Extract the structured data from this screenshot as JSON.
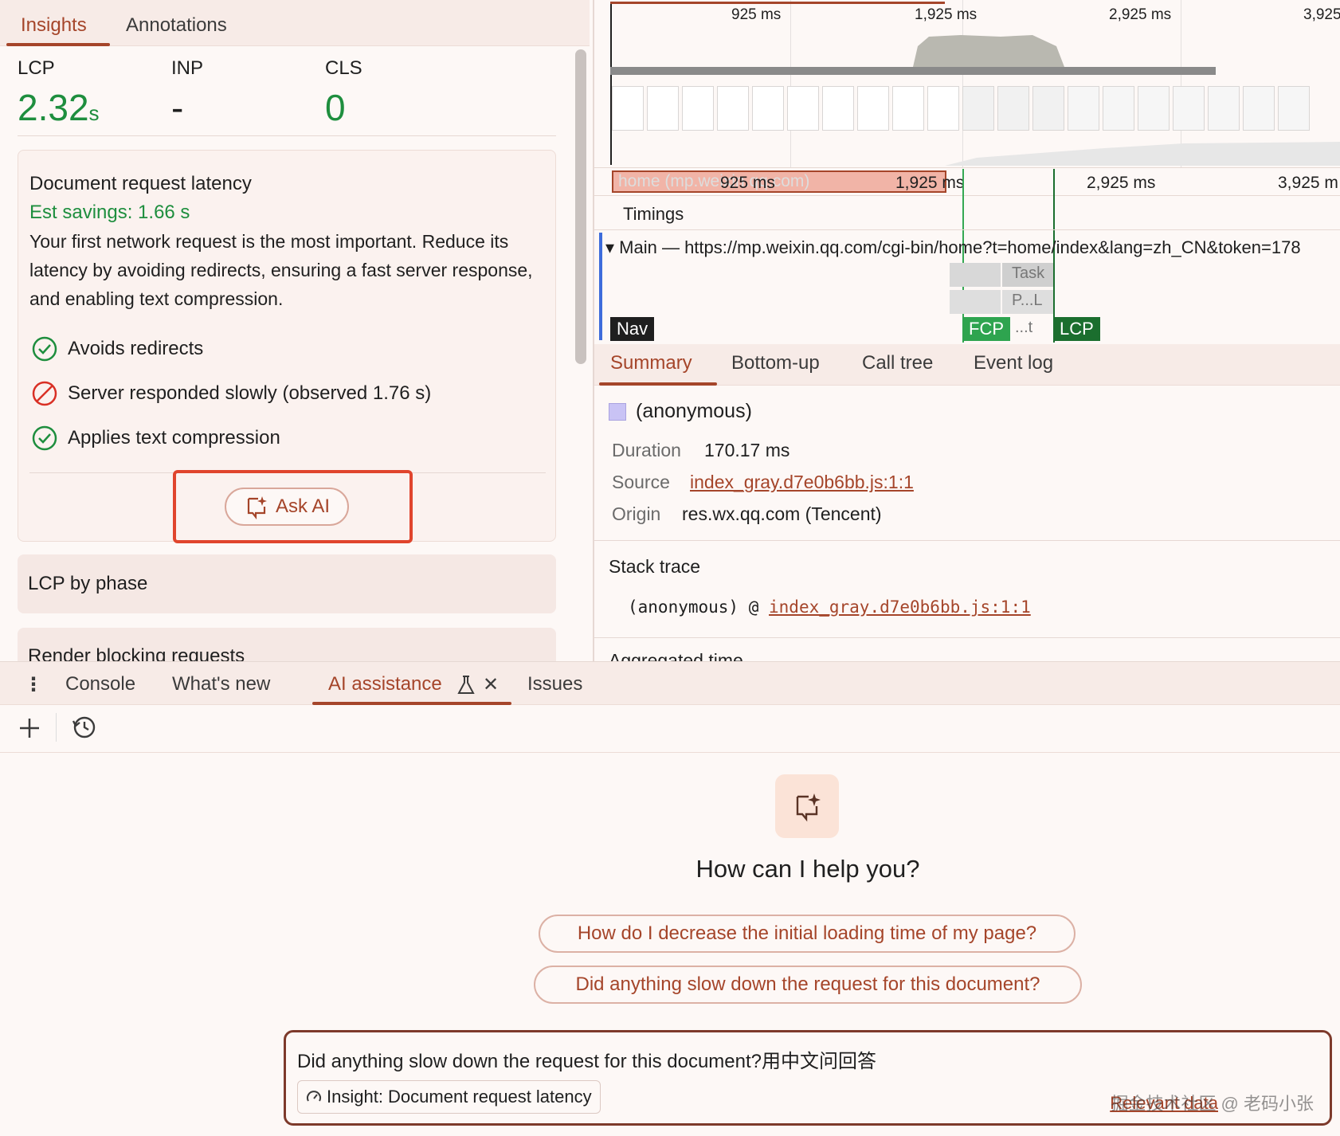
{
  "left_panel": {
    "tabs": [
      {
        "label": "Insights",
        "active": true
      },
      {
        "label": "Annotations",
        "active": false
      }
    ],
    "metrics": [
      {
        "label": "LCP",
        "value": "2.32",
        "unit": "s"
      },
      {
        "label": "INP",
        "value": "-",
        "unit": ""
      },
      {
        "label": "CLS",
        "value": "0",
        "unit": ""
      }
    ],
    "insight_card": {
      "title": "Document request latency",
      "savings": "Est savings: 1.66 s",
      "description": "Your first network request is the most important. Reduce its latency by avoiding redirects, ensuring a fast server response, and enabling text compression.",
      "checks": [
        {
          "label": "Avoids redirects",
          "status": "pass",
          "icon": "check-circle-icon"
        },
        {
          "label": "Server responded slowly (observed 1.76 s)",
          "status": "fail",
          "icon": "blocked-circle-icon"
        },
        {
          "label": "Applies text compression",
          "status": "pass",
          "icon": "check-circle-icon"
        }
      ],
      "ask_ai_label": "Ask AI"
    },
    "sections": [
      {
        "label": "LCP by phase"
      },
      {
        "label": "Render blocking requests"
      }
    ]
  },
  "timeline": {
    "ruler_top": [
      "925 ms",
      "1,925 ms",
      "2,925 ms",
      "3,925"
    ],
    "ruler_main": [
      "925 ms",
      "1,925 ms",
      "2,925 ms",
      "3,925 m"
    ],
    "network_bar_label": "home (mp.weixin.qq.com)",
    "timings_label": "Timings",
    "main_track": "Main — https://mp.weixin.qq.com/cgi-bin/home?t=home/index&lang=zh_CN&token=178",
    "task_labels": [
      "Task",
      "P...L",
      "...t"
    ],
    "markers": [
      "Nav",
      "FCP",
      "LCP"
    ]
  },
  "summary": {
    "tabs": [
      {
        "label": "Summary",
        "active": true
      },
      {
        "label": "Bottom-up",
        "active": false
      },
      {
        "label": "Call tree",
        "active": false
      },
      {
        "label": "Event log",
        "active": false
      }
    ],
    "title": "(anonymous)",
    "duration_key": "Duration",
    "duration_val": "170.17 ms",
    "source_key": "Source",
    "source_val": "index_gray.d7e0b6bb.js:1:1",
    "origin_key": "Origin",
    "origin_val": "res.wx.qq.com (Tencent)",
    "stack_title": "Stack trace",
    "stack_fn": "(anonymous) @ ",
    "stack_link": "index_gray.d7e0b6bb.js:1:1",
    "aggregated_title": "Aggregated time",
    "swatch_color": "#c9c3f5"
  },
  "drawer": {
    "tabs": [
      {
        "label": "Console",
        "active": false
      },
      {
        "label": "What's new",
        "active": false
      },
      {
        "label": "AI assistance",
        "active": true
      },
      {
        "label": "Issues",
        "active": false
      }
    ],
    "help_title": "How can I help you?",
    "suggestions": [
      "How do I decrease the initial loading time of my page?",
      "Did anything slow down the request for this document?"
    ],
    "input_value": "Did anything slow down the request for this document?用中文问回答",
    "context_chip": "Insight: Document request latency",
    "relevant_link": "Relevant data",
    "watermark": "掘金技术社区 @ 老码小张"
  },
  "colors": {
    "accent": "#a5452a",
    "good": "#1e8e3e",
    "bad": "#d93025",
    "highlight": "#e0452d"
  }
}
